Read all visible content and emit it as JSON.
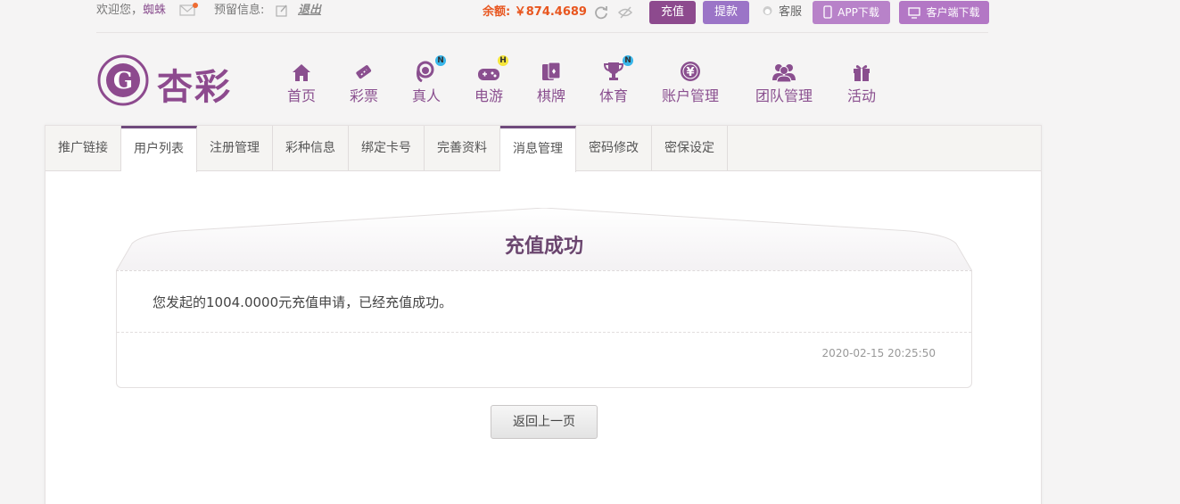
{
  "topbar": {
    "welcome": "欢迎您，",
    "username": "蜘蛛",
    "reserved_info": "预留信息:",
    "logout": "退出",
    "balance": "余额: ￥874.4689",
    "recharge": "充值",
    "withdraw": "提款",
    "service": "客服",
    "app_download": "APP下载",
    "client_download": "客户端下载"
  },
  "logo": {
    "text": "杏彩",
    "color": "#8d4a8e"
  },
  "nav": [
    {
      "label": "首页",
      "icon": "home-icon"
    },
    {
      "label": "彩票",
      "icon": "lottery-ticket-icon"
    },
    {
      "label": "真人",
      "icon": "live-dealer-icon",
      "badge": "N"
    },
    {
      "label": "电游",
      "icon": "gamepad-icon",
      "badge": "H"
    },
    {
      "label": "棋牌",
      "icon": "cards-icon"
    },
    {
      "label": "体育",
      "icon": "trophy-icon",
      "badge": "N"
    },
    {
      "label": "账户管理",
      "icon": "yen-coin-icon"
    },
    {
      "label": "团队管理",
      "icon": "team-icon"
    },
    {
      "label": "活动",
      "icon": "gift-icon"
    }
  ],
  "tabs": [
    "推广链接",
    "用户列表",
    "注册管理",
    "彩种信息",
    "绑定卡号",
    "完善资料",
    "消息管理",
    "密码修改",
    "密保设定"
  ],
  "message": {
    "title": "充值成功",
    "body": "您发起的1004.0000元充值申请，已经充值成功。",
    "time": "2020-02-15 20:25:50"
  },
  "back_button": "返回上一页",
  "colors": {
    "brand": "#8d4a8e",
    "accent": "#e8561f",
    "tab_active": "#6f4a7c"
  }
}
